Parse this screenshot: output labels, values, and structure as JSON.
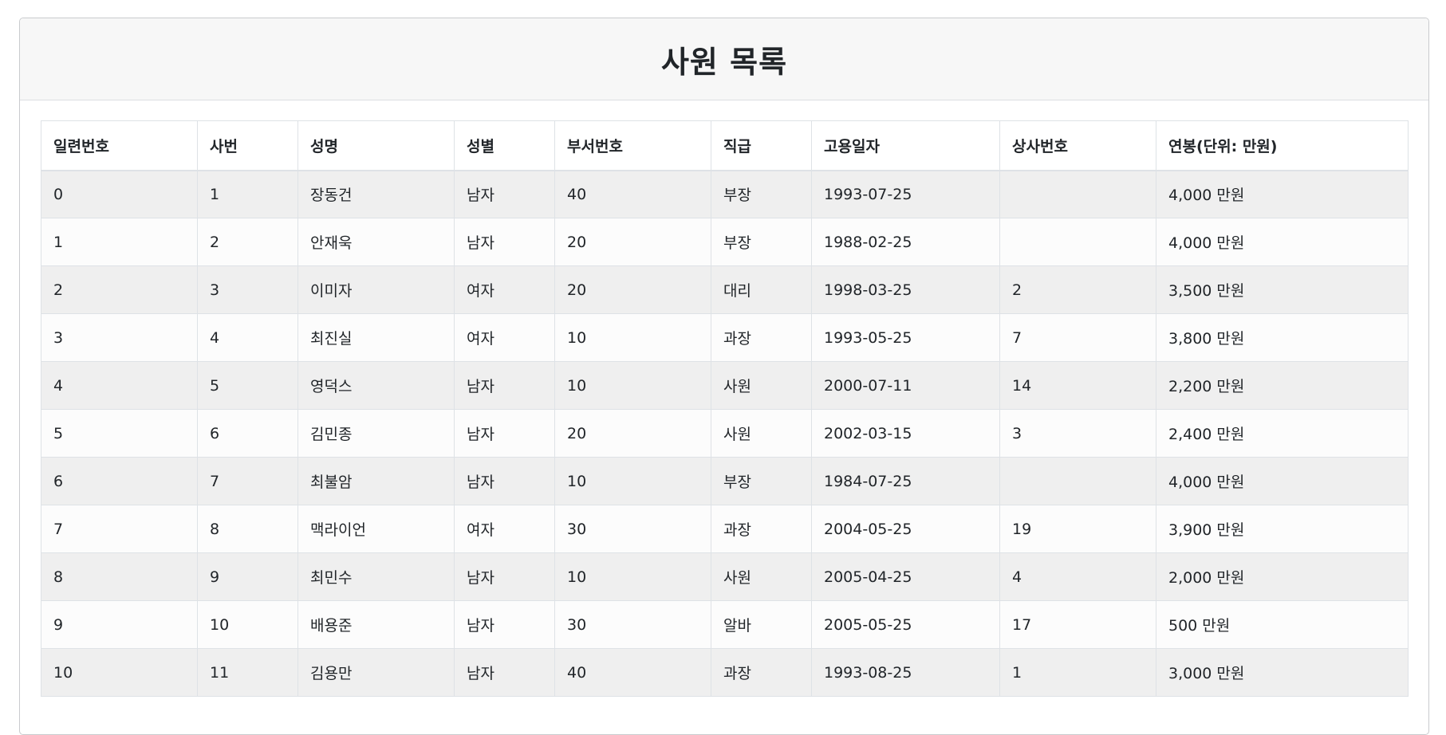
{
  "page": {
    "title": "사원 목록"
  },
  "table": {
    "columns": [
      "일련번호",
      "사번",
      "성명",
      "성별",
      "부서번호",
      "직급",
      "고용일자",
      "상사번호",
      "연봉(단위: 만원)"
    ],
    "rows": [
      [
        "0",
        "1",
        "장동건",
        "남자",
        "40",
        "부장",
        "1993-07-25",
        "",
        "4,000 만원"
      ],
      [
        "1",
        "2",
        "안재욱",
        "남자",
        "20",
        "부장",
        "1988-02-25",
        "",
        "4,000 만원"
      ],
      [
        "2",
        "3",
        "이미자",
        "여자",
        "20",
        "대리",
        "1998-03-25",
        "2",
        "3,500 만원"
      ],
      [
        "3",
        "4",
        "최진실",
        "여자",
        "10",
        "과장",
        "1993-05-25",
        "7",
        "3,800 만원"
      ],
      [
        "4",
        "5",
        "영덕스",
        "남자",
        "10",
        "사원",
        "2000-07-11",
        "14",
        "2,200 만원"
      ],
      [
        "5",
        "6",
        "김민종",
        "남자",
        "20",
        "사원",
        "2002-03-15",
        "3",
        "2,400 만원"
      ],
      [
        "6",
        "7",
        "최불암",
        "남자",
        "10",
        "부장",
        "1984-07-25",
        "",
        "4,000 만원"
      ],
      [
        "7",
        "8",
        "맥라이언",
        "여자",
        "30",
        "과장",
        "2004-05-25",
        "19",
        "3,900 만원"
      ],
      [
        "8",
        "9",
        "최민수",
        "남자",
        "10",
        "사원",
        "2005-04-25",
        "4",
        "2,000 만원"
      ],
      [
        "9",
        "10",
        "배용준",
        "남자",
        "30",
        "알바",
        "2005-05-25",
        "17",
        "500 만원"
      ],
      [
        "10",
        "11",
        "김용만",
        "남자",
        "40",
        "과장",
        "1993-08-25",
        "1",
        "3,000 만원"
      ]
    ]
  }
}
